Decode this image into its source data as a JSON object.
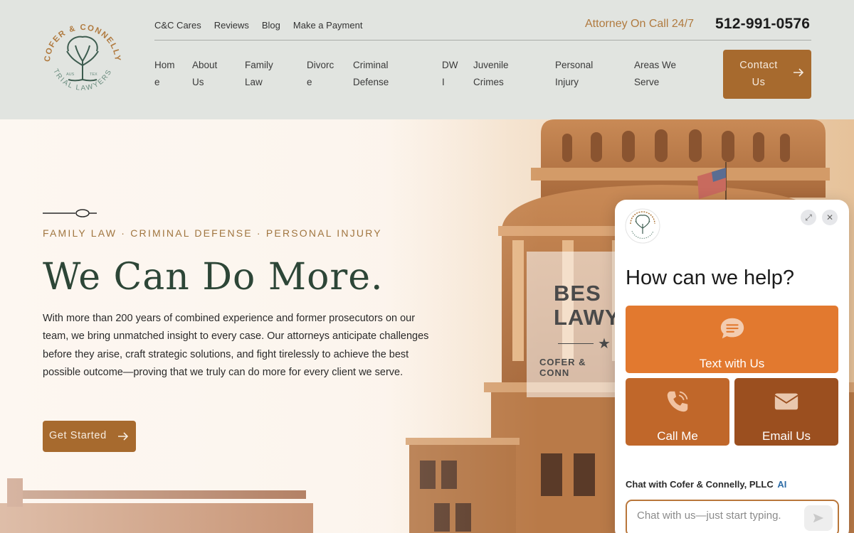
{
  "header": {
    "logo": {
      "top_text": "COFER & CONNELLY",
      "bottom_text": "TRIAL LAWYERS",
      "left_mark": "AUS",
      "right_mark": "TEX"
    },
    "top_links": [
      "C&C Cares",
      "Reviews",
      "Blog",
      "Make a Payment"
    ],
    "on_call_label": "Attorney On Call 24/7",
    "phone": "512-991-0576",
    "nav": [
      {
        "line1": "Hom",
        "line2": "e"
      },
      {
        "line1": "About",
        "line2": "Us"
      },
      {
        "line1": "Family",
        "line2": "Law"
      },
      {
        "line1": "Divorc",
        "line2": "e"
      },
      {
        "line1": "Criminal",
        "line2": "Defense"
      },
      {
        "line1": "DW",
        "line2": "I"
      },
      {
        "line1": "Juvenile",
        "line2": "Crimes"
      },
      {
        "line1": "Personal",
        "line2": "Injury"
      },
      {
        "line1": "Areas We",
        "line2": "Serve"
      }
    ],
    "contact_button": {
      "line1": "Contact",
      "line2": "Us"
    }
  },
  "hero": {
    "tagline": "FAMILY LAW · CRIMINAL DEFENSE · PERSONAL INJURY",
    "headline": "We Can Do More.",
    "body": "With more than 200 years of combined experience and former prosecutors on our team, we bring unmatched insight to every case. Our attorneys anticipate challenges before they arise, craft strategic solutions, and fight tirelessly to achieve the best possible outcome—proving that we truly can do more for every client we serve.",
    "cta_label": "Get Started",
    "banner": {
      "line1": "BES",
      "line2": "LAWY",
      "star": "★",
      "small": "COFER & CONN"
    }
  },
  "chat": {
    "title": "How can we help?",
    "text_label": "Text with Us",
    "call_label": "Call Me",
    "email_label": "Email Us",
    "chat_with": "Chat with Cofer & Connelly, PLLC",
    "ai_badge": "AI",
    "input_placeholder": "Chat with us—just start typing.",
    "expand_icon": "⤢",
    "close_icon": "✕"
  },
  "colors": {
    "header_bg": "#e1e4e0",
    "accent": "#a76a2e",
    "headline_green": "#2d4637",
    "chat_text_card": "#e2792f",
    "chat_call_card": "#c0672a",
    "chat_email_card": "#9b4f1f"
  }
}
